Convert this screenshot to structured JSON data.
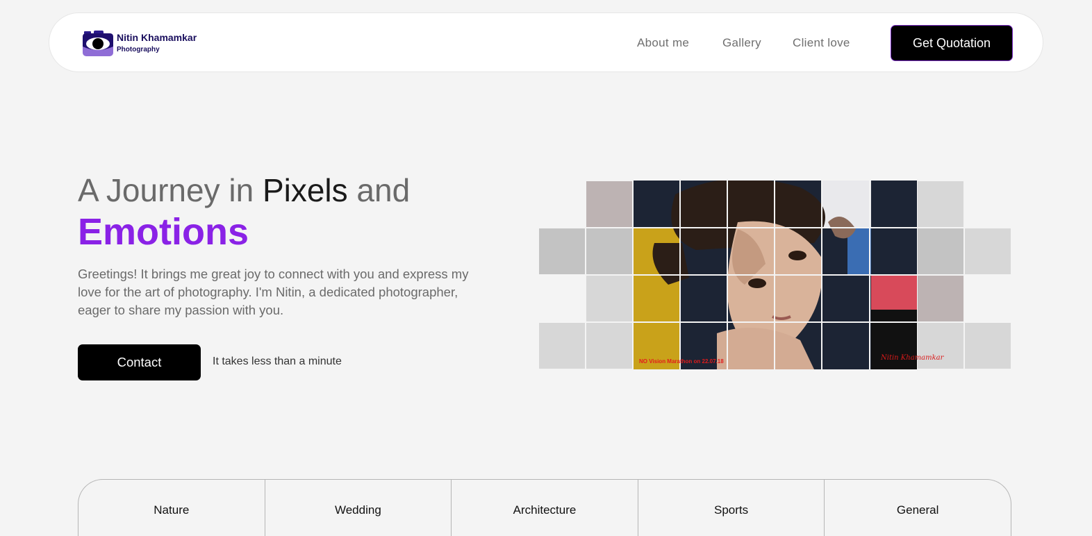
{
  "brand": {
    "name": "Nitin Khamamkar",
    "tagline": "Photography",
    "colors": {
      "primary": "#8a22e6",
      "navy": "#1a0f5e",
      "button": "#000000"
    }
  },
  "nav": {
    "links": [
      "About me",
      "Gallery",
      "Client love"
    ],
    "cta_label": "Get Quotation"
  },
  "hero": {
    "title_part1": "A Journey in ",
    "title_emphasis": "Pixels",
    "title_part2": " and",
    "title_highlight": "Emotions",
    "description": "Greetings! It brings me great joy to connect with you and express my love for the art of photography. I'm Nitin, a dedicated photographer, eager to share my passion with you.",
    "contact_label": "Contact",
    "contact_note": "It takes less than a minute"
  },
  "photo": {
    "watermark": "NO Vision Marathon on 22.07.18",
    "signature": "Nitin Khamamkar"
  },
  "categories": [
    "Nature",
    "Wedding",
    "Architecture",
    "Sports",
    "General"
  ]
}
